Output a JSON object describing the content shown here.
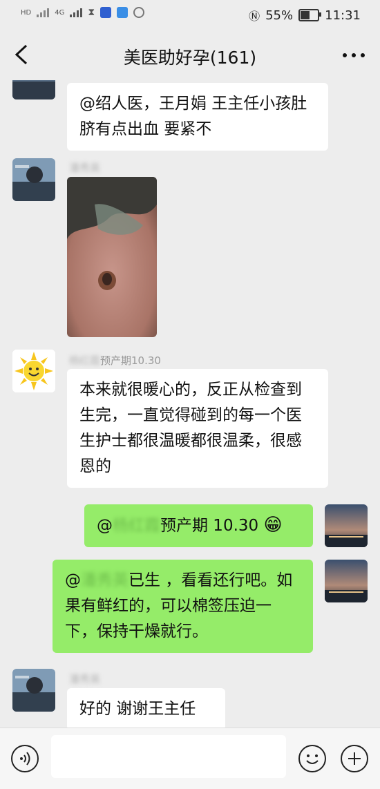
{
  "status_bar": {
    "left_text": "HD",
    "network": "4G",
    "battery": "55%",
    "time": "11:31"
  },
  "header": {
    "title": "美医助好孕(161)"
  },
  "messages": {
    "m1": {
      "text": "@绍人医，王月娟  王主任小孩肚脐有点出血 要紧不"
    },
    "m2": {
      "sender": "潘秀英"
    },
    "m3": {
      "sender_blur": "杨红霞",
      "sender_suffix": "预产期10.30",
      "text": "本来就很暖心的，反正从检查到生完，一直觉得碰到的每一个医生护士都很温暖都很温柔，很感恩的"
    },
    "m4": {
      "prefix": "@",
      "mention": "杨红霞",
      "text": "预产期 10.30",
      "emoji": "😁"
    },
    "m5": {
      "prefix": "@",
      "mention": "潘秀英",
      "text": "已生 ，看看还行吧。如果有鲜红的，可以棉签压迫一下，保持干燥就行。"
    },
    "m6": {
      "sender": "潘秀英",
      "text": "好的 谢谢王主任"
    }
  },
  "colors": {
    "background": "#ededed",
    "my_bubble": "#95ec69",
    "their_bubble": "#ffffff"
  }
}
